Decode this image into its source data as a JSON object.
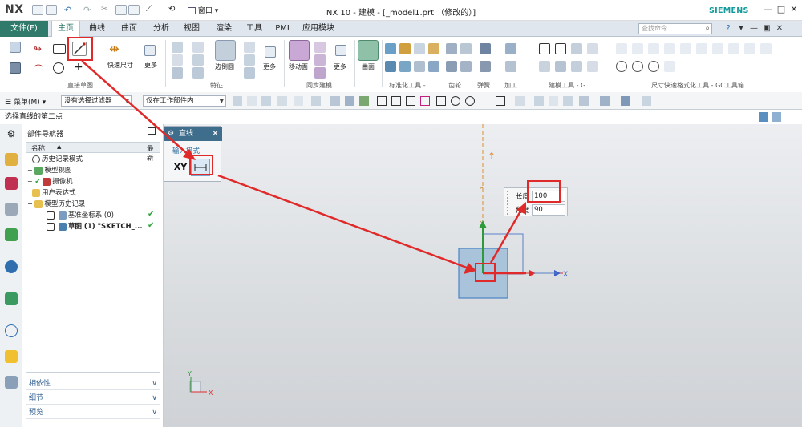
{
  "window": {
    "logo": "NX",
    "title": "NX 10 - 建模 - [_model1.prt （修改的）]",
    "brand": "SIEMENS",
    "window_menu": "窗口"
  },
  "ribbon": {
    "file_tab": "文件(F)",
    "tabs": [
      "主页",
      "曲线",
      "曲面",
      "分析",
      "视图",
      "渲染",
      "工具",
      "PMI",
      "应用模块"
    ],
    "active_tab": "主页",
    "search_placeholder": "查找命令",
    "groups": {
      "direct_sketch": "直接草图",
      "feature": "特征",
      "sync_modeling": "同步建模",
      "standard_parts": "标准化工具 - ...",
      "gear": "齿轮...",
      "spring": "弹簧...",
      "machining": "加工...",
      "modeling_tools": "建模工具 - G...",
      "dimension_tools": "尺寸快速格式化工具 - GC工具箱"
    },
    "buttons": {
      "rapid_dimension": "快速尺寸",
      "more_1": "更多",
      "edge_blend": "边倒圆",
      "more_2": "更多",
      "move_face": "移动面",
      "more_3": "更多",
      "surface": "曲面"
    }
  },
  "selection_bar": {
    "menu": "菜单(M)",
    "filter": "没有选择过滤器",
    "scope": "仅在工作部件内"
  },
  "cue_line": "选择直线的第二点",
  "navigator": {
    "title": "部件导航器",
    "col_name": "名称",
    "col_recent": "最新",
    "tree": [
      {
        "label": "历史记录模式",
        "checked": false
      },
      {
        "label": "模型视图",
        "checked": false
      },
      {
        "label": "摄像机",
        "checked": false
      },
      {
        "label": "用户表达式",
        "checked": false
      },
      {
        "label": "模型历史记录",
        "checked": false
      },
      {
        "label": "基准坐标系 (0)",
        "checked": true
      },
      {
        "label": "草图 (1) \"SKETCH_...",
        "checked": true
      }
    ],
    "sections": [
      "相依性",
      "细节",
      "预览"
    ]
  },
  "dialog": {
    "title": "直线",
    "mode_label": "输入模式",
    "xy_label": "XY"
  },
  "inputs": {
    "length_label": "长度",
    "length_value": "100",
    "angle_label": "角度",
    "angle_value": "90"
  },
  "axes": {
    "x_label": "X",
    "y_label": "Y",
    "x_label_small": "X",
    "y_label_small": "Y"
  },
  "colors": {
    "accent": "#2f7a6a",
    "annotation_red": "#e02a2a",
    "axis_x": "#e02a2a",
    "axis_y": "#2e9a3a",
    "siemens": "#149a9b"
  }
}
